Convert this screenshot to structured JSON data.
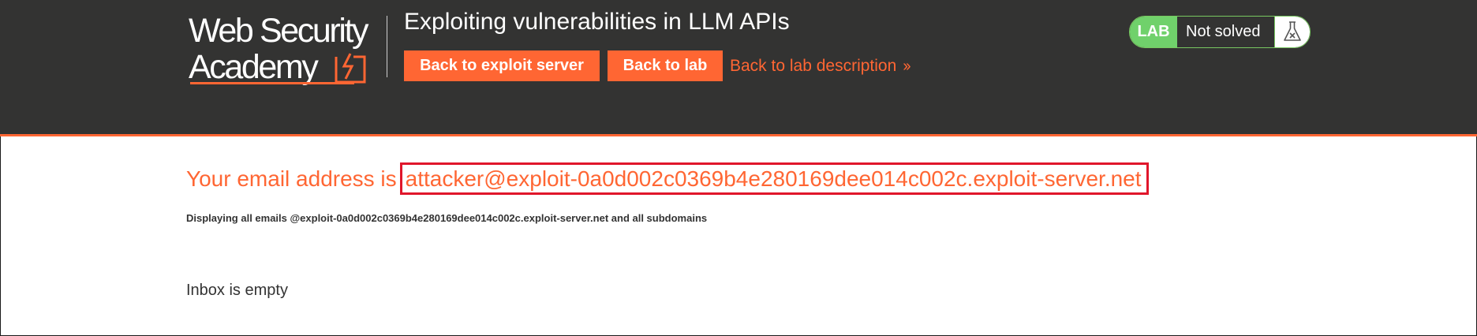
{
  "header": {
    "logo": {
      "line1": "Web Security",
      "line2": "Academy"
    },
    "title": "Exploiting vulnerabilities in LLM APIs",
    "buttons": {
      "exploit_server": "Back to exploit server",
      "lab": "Back to lab"
    },
    "lab_description_link": "Back to lab description",
    "lab_status": {
      "badge": "LAB",
      "text": "Not solved",
      "icon": "flask-icon"
    }
  },
  "main": {
    "email_prefix": "Your email address is",
    "email_address": "attacker@exploit-0a0d002c0369b4e280169dee014c002c.exploit-server.net",
    "display_note": "Displaying all emails @exploit-0a0d002c0369b4e280169dee014c002c.exploit-server.net and all subdomains",
    "inbox_status": "Inbox is empty"
  },
  "colors": {
    "brand_orange": "#ff6633",
    "header_bg": "#333332",
    "lab_green": "#70d16b",
    "highlight_red": "#e0162b"
  }
}
